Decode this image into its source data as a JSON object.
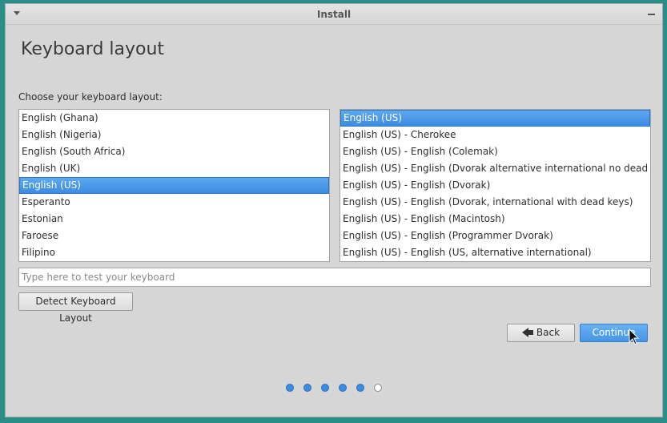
{
  "window": {
    "title": "Install"
  },
  "page": {
    "heading": "Keyboard layout",
    "choose_label": "Choose your keyboard layout:"
  },
  "layouts": {
    "items": [
      "English (Ghana)",
      "English (Nigeria)",
      "English (South Africa)",
      "English (UK)",
      "English (US)",
      "Esperanto",
      "Estonian",
      "Faroese",
      "Filipino"
    ],
    "selected": "English (US)"
  },
  "variants": {
    "items": [
      "English (US)",
      "English (US) - Cherokee",
      "English (US) - English (Colemak)",
      "English (US) - English (Dvorak alternative international no dead keys)",
      "English (US) - English (Dvorak)",
      "English (US) - English (Dvorak, international with dead keys)",
      "English (US) - English (Macintosh)",
      "English (US) - English (Programmer Dvorak)",
      "English (US) - English (US, alternative international)"
    ],
    "selected": "English (US)"
  },
  "test_input": {
    "placeholder": "Type here to test your keyboard",
    "value": ""
  },
  "buttons": {
    "detect": "Detect Keyboard Layout",
    "back": "Back",
    "continue": "Continue"
  },
  "progress": {
    "total_steps": 6,
    "completed_steps": 5
  },
  "colors": {
    "accent": "#3b8ce3",
    "window_bg": "#d6d6d6",
    "desktop_bg": "#2a8d88"
  }
}
